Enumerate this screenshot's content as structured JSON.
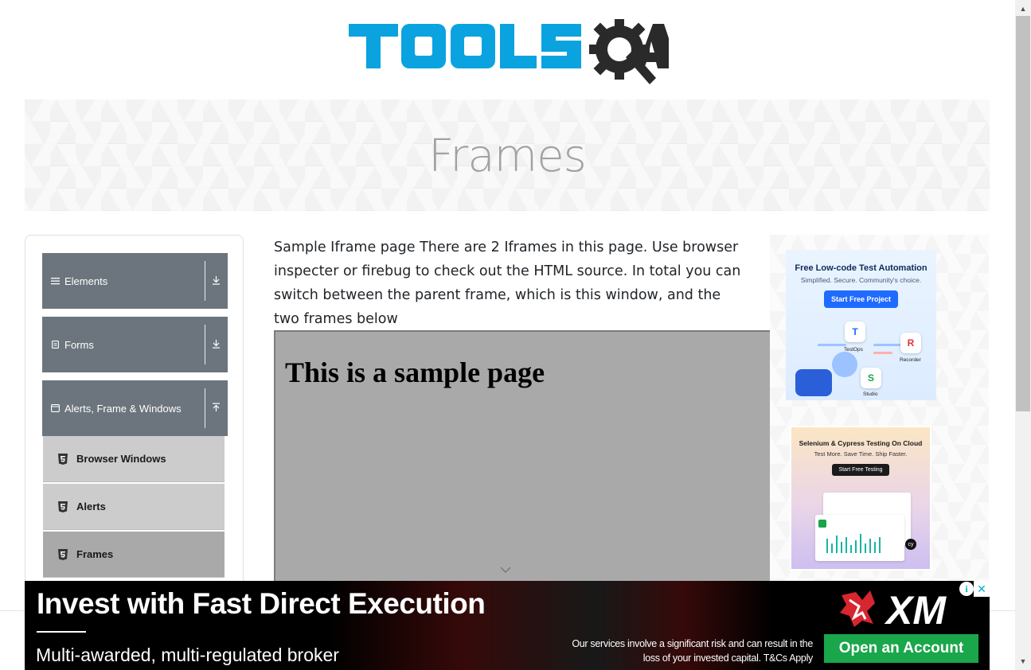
{
  "header": {
    "logo_text": "TOOLSQA",
    "brand_blue": "#0aa3df",
    "brand_dark": "#2a2a2a"
  },
  "banner": {
    "title": "Frames"
  },
  "sidebar": {
    "groups": [
      {
        "label": "Elements",
        "icon": "hamburger-icon",
        "expanded": false
      },
      {
        "label": "Forms",
        "icon": "document-icon",
        "expanded": false
      },
      {
        "label": "Alerts, Frame & Windows",
        "icon": "window-icon",
        "expanded": true
      }
    ],
    "items": [
      {
        "label": "Browser Windows",
        "active": false
      },
      {
        "label": "Alerts",
        "active": false
      },
      {
        "label": "Frames",
        "active": true
      }
    ]
  },
  "main": {
    "intro": "Sample Iframe page There are 2 Iframes in this page. Use browser inspecter or firebug to check out the HTML source. In total you can switch between the parent frame, which is this window, and the two frames below",
    "frame_heading": "This is a sample page"
  },
  "right_ads": {
    "ad1": {
      "title": "Free Low-code Test Automation",
      "subtitle": "Simplified. Secure. Community's choice.",
      "button": "Start Free Project",
      "labels": [
        "TestOps",
        "Recorder",
        "Studio"
      ]
    },
    "ad2": {
      "title": "Selenium & Cypress Testing On Cloud",
      "subtitle": "Test More. Save Time. Ship Faster.",
      "button": "Start Free Testing"
    }
  },
  "bottom_ad": {
    "headline": "Invest with Fast Direct Execution",
    "subline": "Multi-awarded, multi-regulated broker",
    "risk_line1": "Our services involve a significant risk and can result in the",
    "risk_line2": "loss of your invested capital. T&Cs Apply",
    "cta": "Open an Account",
    "brand": "XM",
    "cta_color": "#1aa64a",
    "brand_red": "#d7262f"
  }
}
